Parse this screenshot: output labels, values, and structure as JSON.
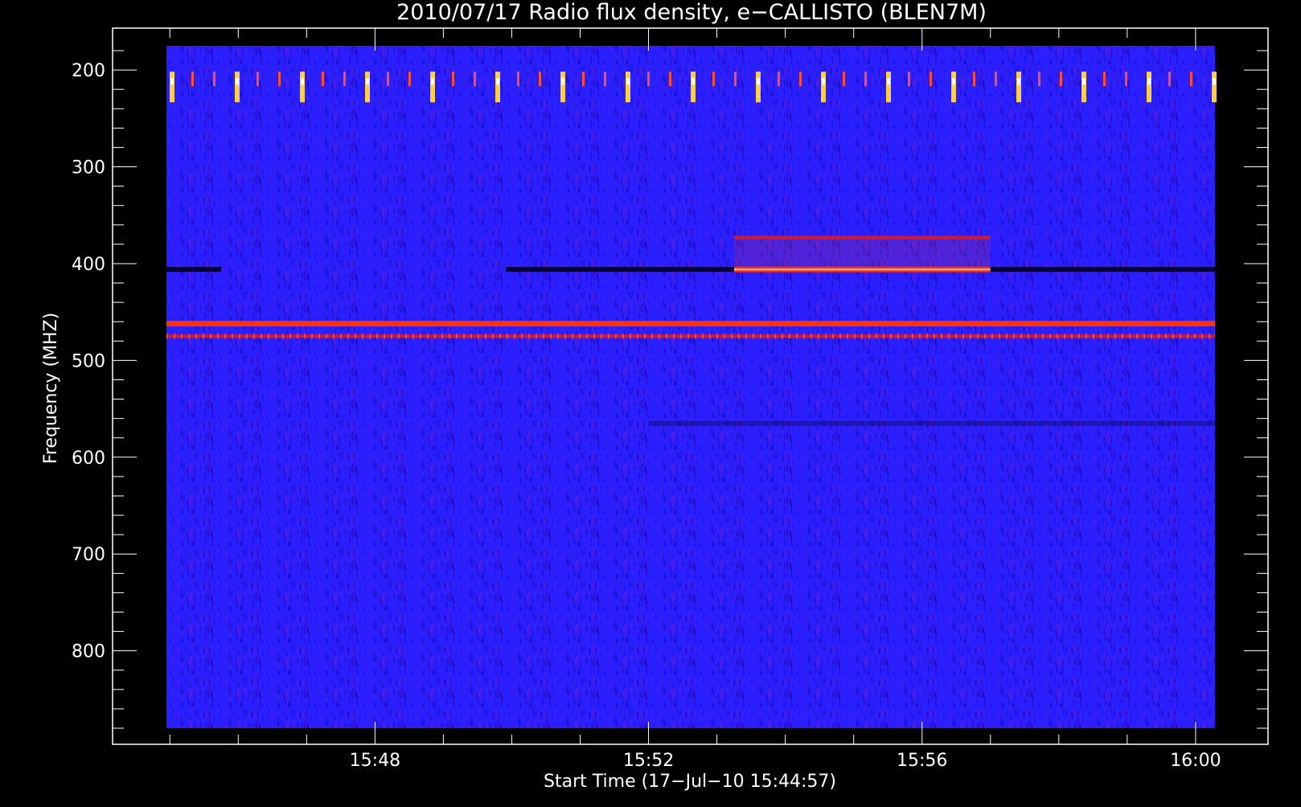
{
  "chart_data": {
    "type": "heatmap",
    "title": "2010/07/17  Radio flux density, e−CALLISTO (BLEN7M)",
    "xlabel": "Start Time (17−Jul−10 15:44:57)",
    "ylabel": "Frequency (MHZ)",
    "x_unit": "time (UT)",
    "xlim": [
      "15:44:57",
      "16:00:17"
    ],
    "ylim": [
      880,
      175
    ],
    "y_axis_inverted": true,
    "x_ticks": [
      "15:48",
      "15:52",
      "15:56",
      "16:00"
    ],
    "y_ticks": [
      200,
      300,
      400,
      500,
      600,
      700,
      800
    ],
    "colormap": [
      "#000000",
      "#1f0fd0",
      "#2a20ff",
      "#d01010",
      "#ff4020",
      "#ffc040",
      "#ffffff"
    ],
    "background_color": "#2a1fff",
    "features": [
      {
        "label": "Periodic interference bursts",
        "freq_range_mhz": [
          205,
          230
        ],
        "time_range": [
          "15:44:57",
          "16:00:17"
        ],
        "intensity": "high",
        "pattern": "periodic"
      },
      {
        "label": "Enhanced emission 403 MHz",
        "freq_mhz": 406,
        "time_range": [
          "15:53:15",
          "15:57:00"
        ],
        "intensity": "high"
      },
      {
        "label": "Weak emission 373 MHz",
        "freq_mhz": 373,
        "time_range": [
          "15:53:15",
          "15:57:00"
        ],
        "intensity": "medium"
      },
      {
        "label": "Dark band 406 MHz",
        "freq_mhz": 406,
        "time_range": [
          "15:44:57",
          "15:45:45"
        ],
        "intensity": "low"
      },
      {
        "label": "Dark band 406 MHz",
        "freq_mhz": 406,
        "time_range": [
          "15:49:55",
          "15:53:15"
        ],
        "intensity": "low"
      },
      {
        "label": "Dark band 406 MHz",
        "freq_mhz": 406,
        "time_range": [
          "15:57:00",
          "16:00:17"
        ],
        "intensity": "low"
      },
      {
        "label": "Persistent line 462 MHz",
        "freq_mhz": 462,
        "time_range": [
          "15:44:57",
          "16:00:17"
        ],
        "intensity": "high"
      },
      {
        "label": "Intermittent line 475 MHz",
        "freq_mhz": 475,
        "time_range": [
          "15:44:57",
          "16:00:17"
        ],
        "intensity": "medium"
      },
      {
        "label": "Weak band 565 MHz",
        "freq_mhz": 565,
        "time_range": [
          "15:52:00",
          "16:00:17"
        ],
        "intensity": "low"
      }
    ]
  }
}
